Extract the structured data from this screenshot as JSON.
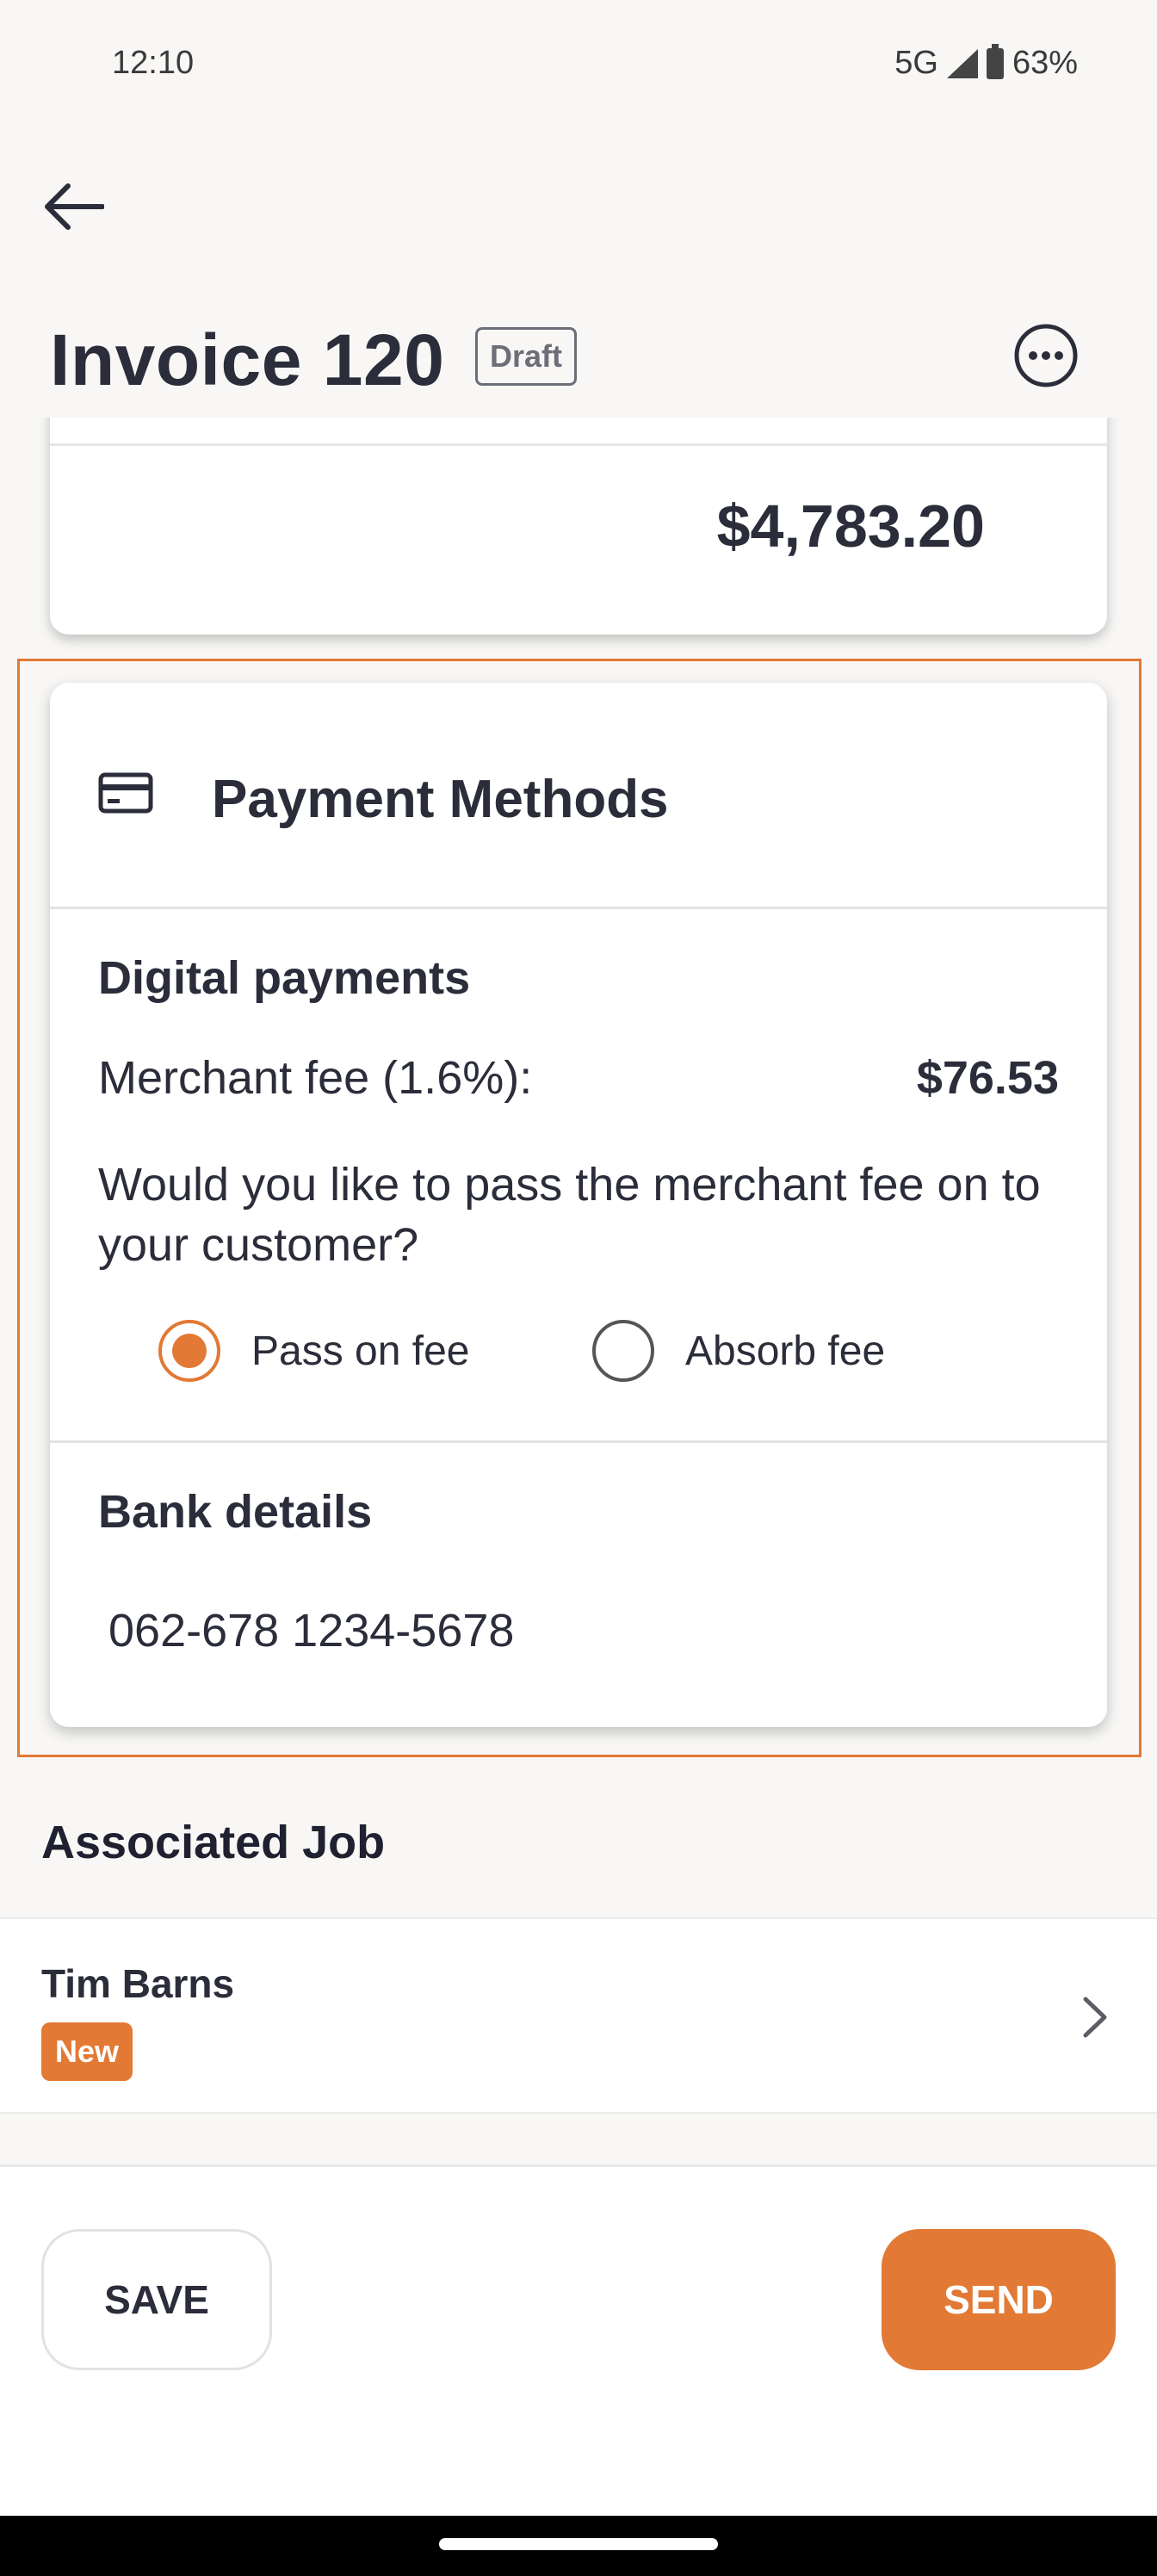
{
  "status": {
    "time": "12:10",
    "network": "5G",
    "battery": "63%"
  },
  "header": {
    "title": "Invoice 120",
    "badge": "Draft"
  },
  "total": {
    "amount": "$4,783.20"
  },
  "payment_methods": {
    "title": "Payment Methods",
    "digital": {
      "heading": "Digital payments",
      "fee_label": "Merchant fee (1.6%):",
      "fee_value": "$76.53",
      "question": "Would you like to pass the merchant fee on to your customer?",
      "options": [
        {
          "label": "Pass on fee",
          "selected": true
        },
        {
          "label": "Absorb fee",
          "selected": false
        }
      ]
    },
    "bank": {
      "heading": "Bank details",
      "number": "062-678 1234-5678"
    }
  },
  "associated_job": {
    "heading": "Associated Job",
    "name": "Tim Barns",
    "status": "New"
  },
  "actions": {
    "save": "SAVE",
    "send": "SEND"
  },
  "colors": {
    "accent": "#e27934",
    "text": "#2b2d3a",
    "background": "#f8f7f5"
  }
}
